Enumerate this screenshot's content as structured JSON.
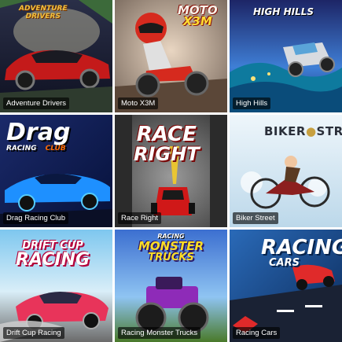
{
  "games": [
    {
      "title": "Adventure Drivers",
      "logo": [
        "ADVENTURE",
        "DRIVERS"
      ]
    },
    {
      "title": "Moto X3M",
      "logo": [
        "MOTO",
        "X3M"
      ]
    },
    {
      "title": "High Hills",
      "logo": [
        "HIGH HILLS"
      ]
    },
    {
      "title": "Drag Racing Club",
      "logo": [
        "Drag",
        "RACING",
        "CLUB"
      ]
    },
    {
      "title": "Race Right",
      "logo": [
        "RACE",
        "RIGHT"
      ]
    },
    {
      "title": "Biker Street",
      "logo": [
        "BIKER",
        "STREET"
      ]
    },
    {
      "title": "Drift Cup Racing",
      "logo": [
        "DRIFT CUP",
        "RACING"
      ]
    },
    {
      "title": "Racing Monster Trucks",
      "logo": [
        "RACING",
        "MONSTER",
        "TRUCKS"
      ]
    },
    {
      "title": "Racing Cars",
      "logo": [
        "RACING",
        "CARS"
      ]
    }
  ],
  "colors": {
    "caption_bg": "#000000",
    "caption_text": "#ffffff"
  },
  "icons": [
    "car-icon",
    "motorbike-icon",
    "monster-truck-icon"
  ]
}
